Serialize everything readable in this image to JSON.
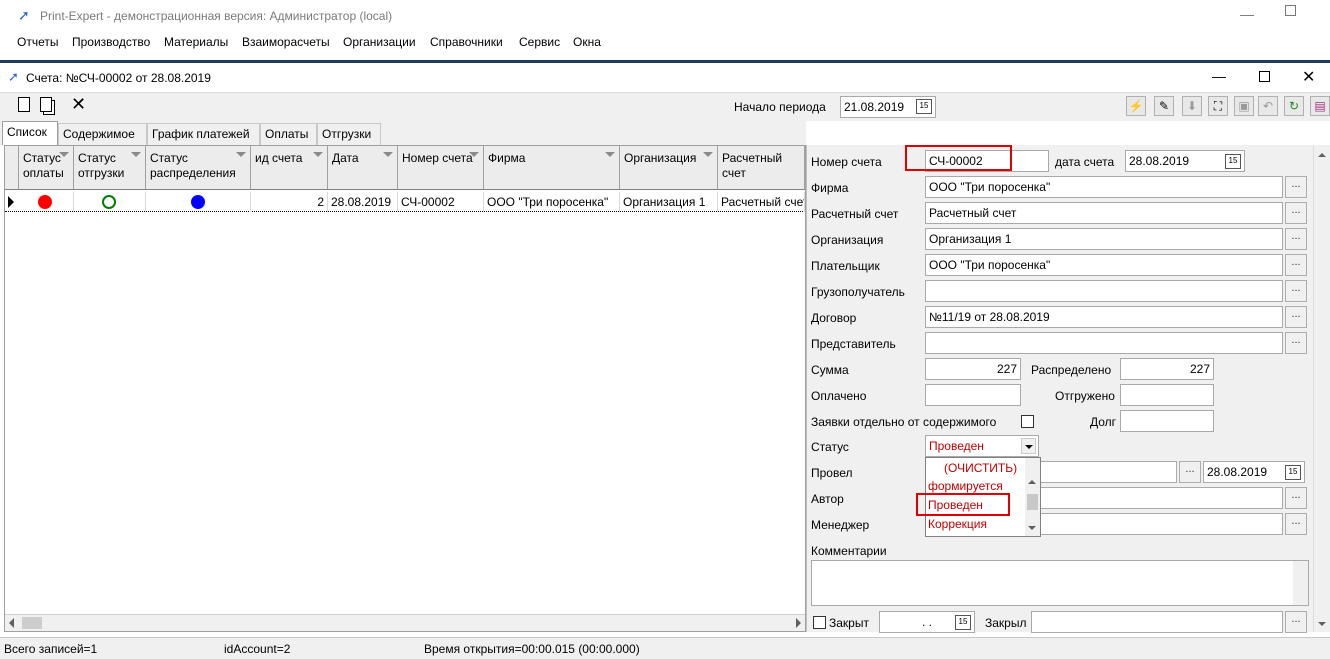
{
  "app": {
    "title": "Print-Expert - демонстрационная версия: Администратор (local)",
    "menu": [
      "Отчеты",
      "Производство",
      "Материалы",
      "Взаиморасчеты",
      "Организации",
      "Справочники",
      "Сервис",
      "Окна"
    ]
  },
  "window": {
    "title": "Счета: №СЧ-00002 от 28.08.2019"
  },
  "toolbar": {
    "period_label": "Начало периода",
    "period_value": "21.08.2019"
  },
  "tabs": [
    "Список",
    "Содержимое",
    "График платежей",
    "Оплаты",
    "Отгрузки"
  ],
  "grid": {
    "columns": [
      "Статус оплаты",
      "Статус отгрузки",
      "Статус распределения",
      "ид счета",
      "Дата",
      "Номер счета",
      "Фирма",
      "Организация",
      "Расчетный счет"
    ],
    "rows": [
      {
        "id": "2",
        "date": "28.08.2019",
        "number": "СЧ-00002",
        "firm": "ООО \"Три поросенка\"",
        "org": "Организация 1",
        "account": "Расчетный счет"
      }
    ],
    "status_colors": {
      "payment": "#ff0000",
      "shipment": "#008000",
      "distribution": "#0000ff"
    }
  },
  "form": {
    "number_label": "Номер счета",
    "number_value": "СЧ-00002",
    "date_label": "дата счета",
    "date_value": "28.08.2019",
    "firm_label": "Фирма",
    "firm_value": "ООО \"Три поросенка\"",
    "account_label": "Расчетный счет",
    "account_value": "Расчетный счет",
    "org_label": "Организация",
    "org_value": "Организация 1",
    "payer_label": "Плательщик",
    "payer_value": "ООО \"Три поросенка\"",
    "consignee_label": "Грузополучатель",
    "consignee_value": "",
    "contract_label": "Договор",
    "contract_value": "№11/19 от 28.08.2019",
    "rep_label": "Представитель",
    "rep_value": "",
    "sum_label": "Сумма",
    "sum_value": "227",
    "distributed_label": "Распределено",
    "distributed_value": "227",
    "paid_label": "Оплачено",
    "paid_value": "",
    "shipped_label": "Отгружено",
    "shipped_value": "",
    "separate_label": "Заявки отдельно от содержимого",
    "debt_label": "Долг",
    "debt_value": "",
    "status_label": "Статус",
    "status_value": "Проведен",
    "conducted_label": "Провел",
    "conducted_date": "28.08.2019",
    "author_label": "Автор",
    "manager_label": "Менеджер",
    "comments_label": "Комментарии",
    "closed_label": "Закрыт",
    "closed_date": ". .",
    "closed_by_label": "Закрыл",
    "status_options": [
      "(ОЧИСТИТЬ)",
      "формируется",
      "Проведен",
      "Коррекция"
    ]
  },
  "statusbar": {
    "records": "Всего записей=1",
    "id": "idAccount=2",
    "time": "Время открытия=00:00.015 (00:00.000)"
  }
}
